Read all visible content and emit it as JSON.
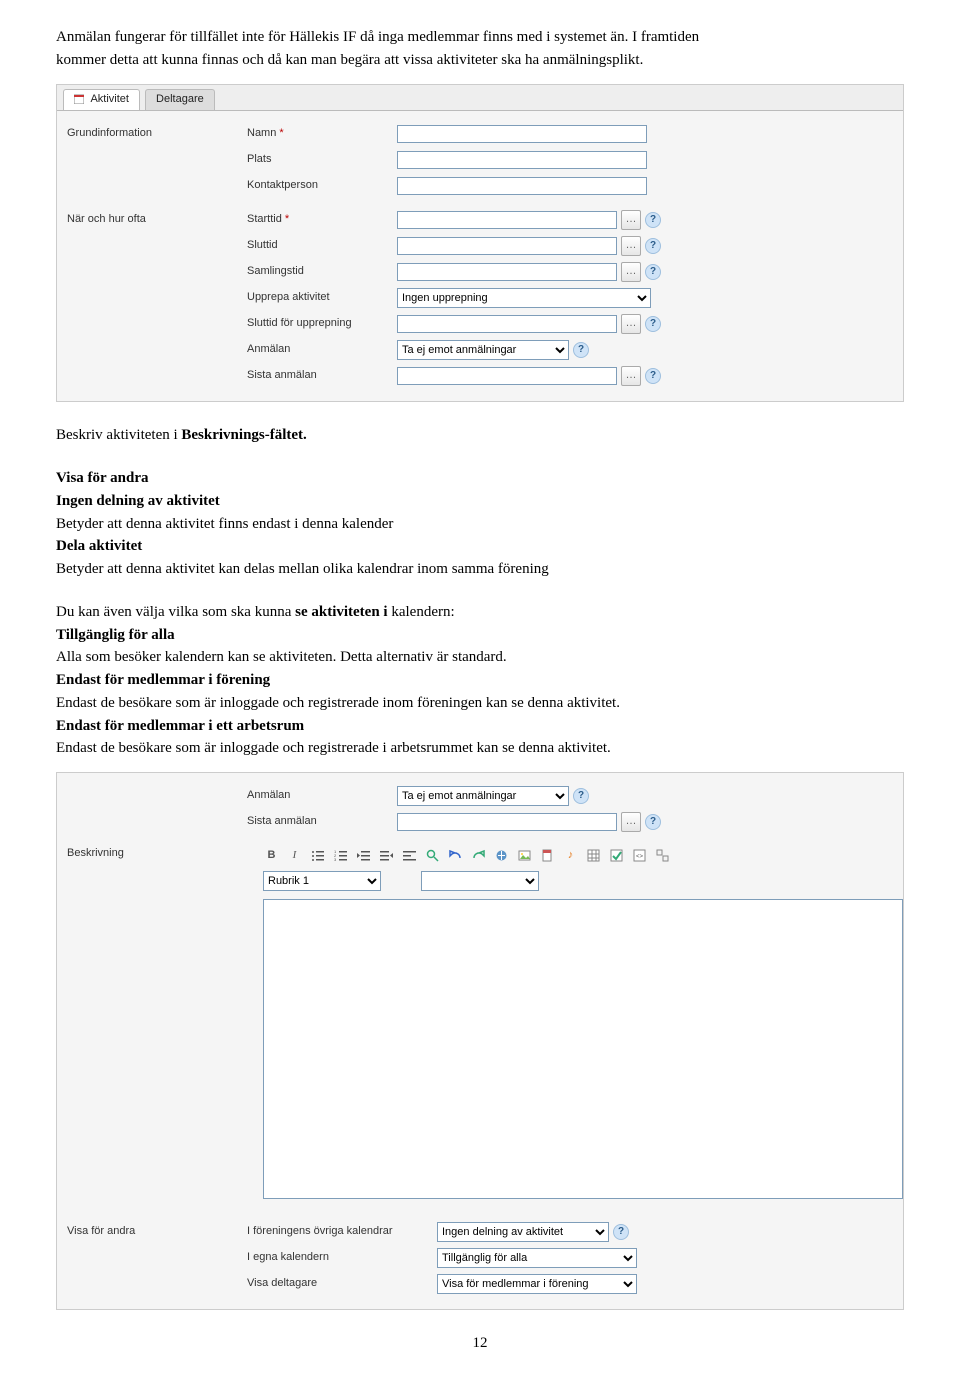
{
  "intro": {
    "p1a": "Anmälan fungerar för tillfället inte för Hällekis IF då inga medlemmar finns med i systemet än. I framtiden",
    "p1b": "kommer detta att kunna finnas och då kan man begära att vissa aktiviteter ska ha anmälningsplikt."
  },
  "panel1": {
    "tabs": {
      "aktivitet": "Aktivitet",
      "deltagare": "Deltagare"
    },
    "groups": {
      "grund": "Grundinformation",
      "nar": "När och hur ofta"
    },
    "rows": {
      "namn": "Namn",
      "plats": "Plats",
      "kontakt": "Kontaktperson",
      "starttid": "Starttid",
      "sluttid": "Sluttid",
      "samlingstid": "Samlingstid",
      "upprepa": "Upprepa aktivitet",
      "sluttid_upp": "Sluttid för upprepning",
      "anmalan": "Anmälan",
      "sista_anmalan": "Sista anmälan"
    },
    "req_mark": "*",
    "select_upprepa": "Ingen upprepning",
    "select_anmalan": "Ta ej emot anmälningar"
  },
  "mid": {
    "beskriv_line_a": "Beskriv aktiviteten i ",
    "beskriv_line_b": "Beskrivnings-fältet.",
    "visa_head": "Visa för andra",
    "ingen_del_head": "Ingen delning av aktivitet",
    "ingen_del_body": "Betyder att denna aktivitet finns endast i denna kalender",
    "dela_head": "Dela aktivitet",
    "dela_body": "Betyder att denna aktivitet kan delas mellan olika kalendrar inom samma förening",
    "aven_a": "Du kan även välja vilka som ska kunna ",
    "aven_b": "se aktiviteten i ",
    "aven_c": "kalendern:",
    "tg_head": "Tillgänglig för alla",
    "tg_body": "Alla som besöker kalendern kan se aktiviteten. Detta alternativ är standard.",
    "efm_head": "Endast för medlemmar i förening",
    "efm_body": "Endast de besökare som är inloggade och registrerade inom föreningen kan se denna aktivitet.",
    "efa_head": "Endast för medlemmar i ett arbetsrum",
    "efa_body": "Endast de besökare som är inloggade och registrerade i arbetsrummet kan se denna aktivitet."
  },
  "panel2": {
    "rows": {
      "anmalan": "Anmälan",
      "sista_anmalan": "Sista anmälan"
    },
    "select_anmalan": "Ta ej emot anmälningar",
    "group_beskriv": "Beskrivning",
    "editor_select1": "Rubrik 1",
    "editor_select2": "",
    "group_visa": "Visa för andra",
    "rows2": {
      "ovriga": "I föreningens övriga kalendrar",
      "egna": "I egna kalendern",
      "deltagare": "Visa deltagare"
    },
    "select_ovriga": "Ingen delning av aktivitet",
    "select_egna": "Tillgänglig för alla",
    "select_deltagare": "Visa för medlemmar i förening"
  },
  "page_number": "12"
}
